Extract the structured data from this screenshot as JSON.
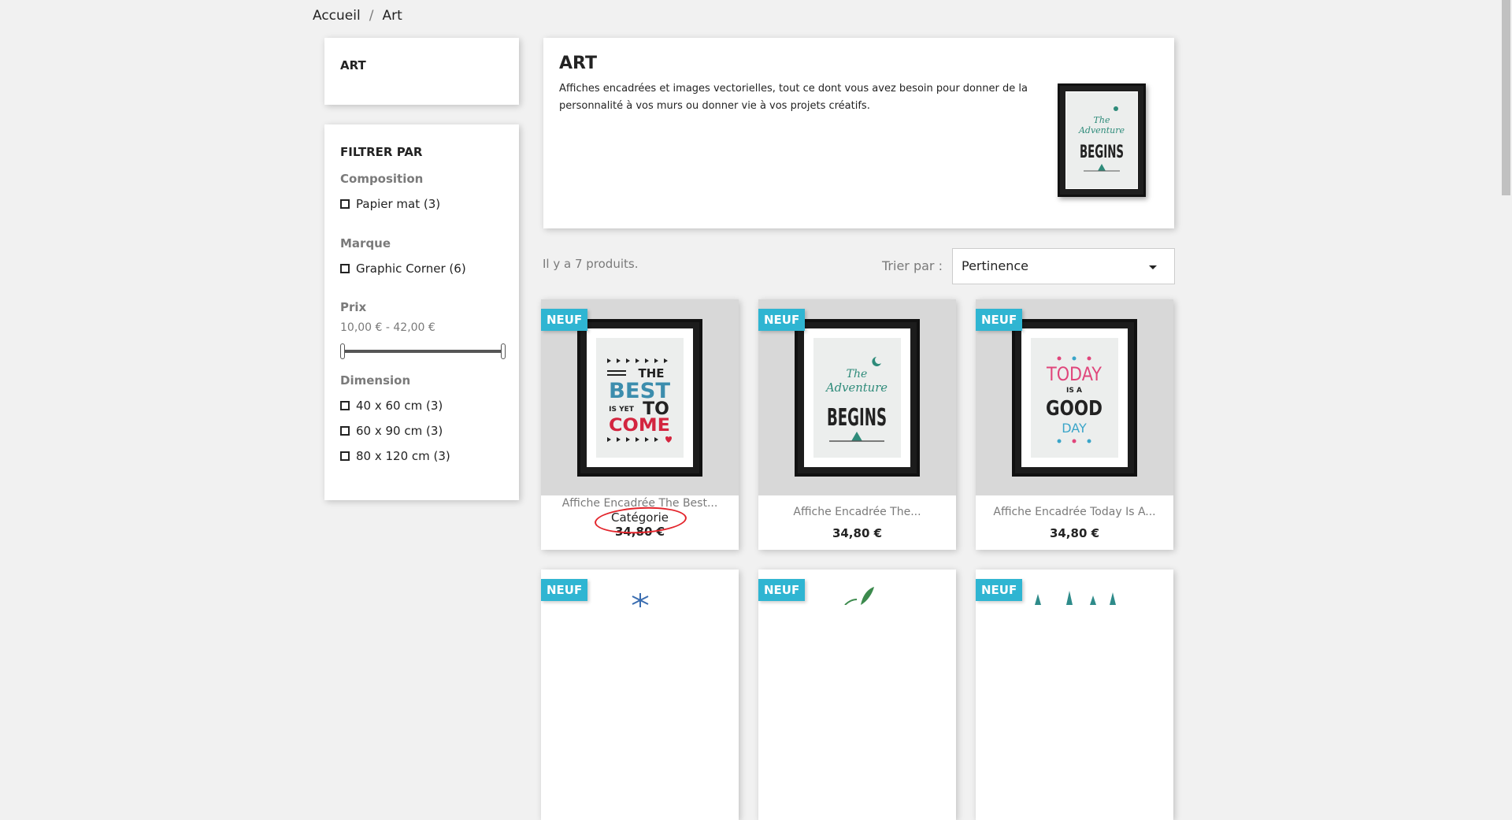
{
  "breadcrumb": {
    "home": "Accueil",
    "separator": "/",
    "current": "Art"
  },
  "category_block": {
    "title": "ART"
  },
  "filters": {
    "title": "FILTRER PAR",
    "composition": {
      "title": "Composition",
      "options": [
        "Papier mat (3)"
      ]
    },
    "brand": {
      "title": "Marque",
      "options": [
        "Graphic Corner (6)"
      ]
    },
    "price": {
      "title": "Prix",
      "range": "10,00 € - 42,00 €"
    },
    "dimension": {
      "title": "Dimension",
      "options": [
        "40 x 60 cm (3)",
        "60 x 90 cm (3)",
        "80 x 120 cm (3)"
      ]
    }
  },
  "header": {
    "title": "ART",
    "description": "Affiches encadrées et images vectorielles, tout ce dont vous avez besoin pour donner de la personnalité à vos murs ou donner vie à vos projets créatifs."
  },
  "listing": {
    "count": "Il y a 7 produits.",
    "sort_label": "Trier par :",
    "sort_value": "Pertinence"
  },
  "products": [
    {
      "badge": "NEUF",
      "name": "Affiche Encadrée The Best...",
      "price": "34,80 €",
      "tooltip": "Catégorie"
    },
    {
      "badge": "NEUF",
      "name": "Affiche Encadrée The...",
      "price": "34,80 €"
    },
    {
      "badge": "NEUF",
      "name": "Affiche Encadrée Today Is A...",
      "price": "34,80 €"
    },
    {
      "badge": "NEUF"
    },
    {
      "badge": "NEUF"
    },
    {
      "badge": "NEUF"
    }
  ],
  "colors": {
    "accent": "#2fb5d2",
    "annotation": "#e3242b"
  }
}
